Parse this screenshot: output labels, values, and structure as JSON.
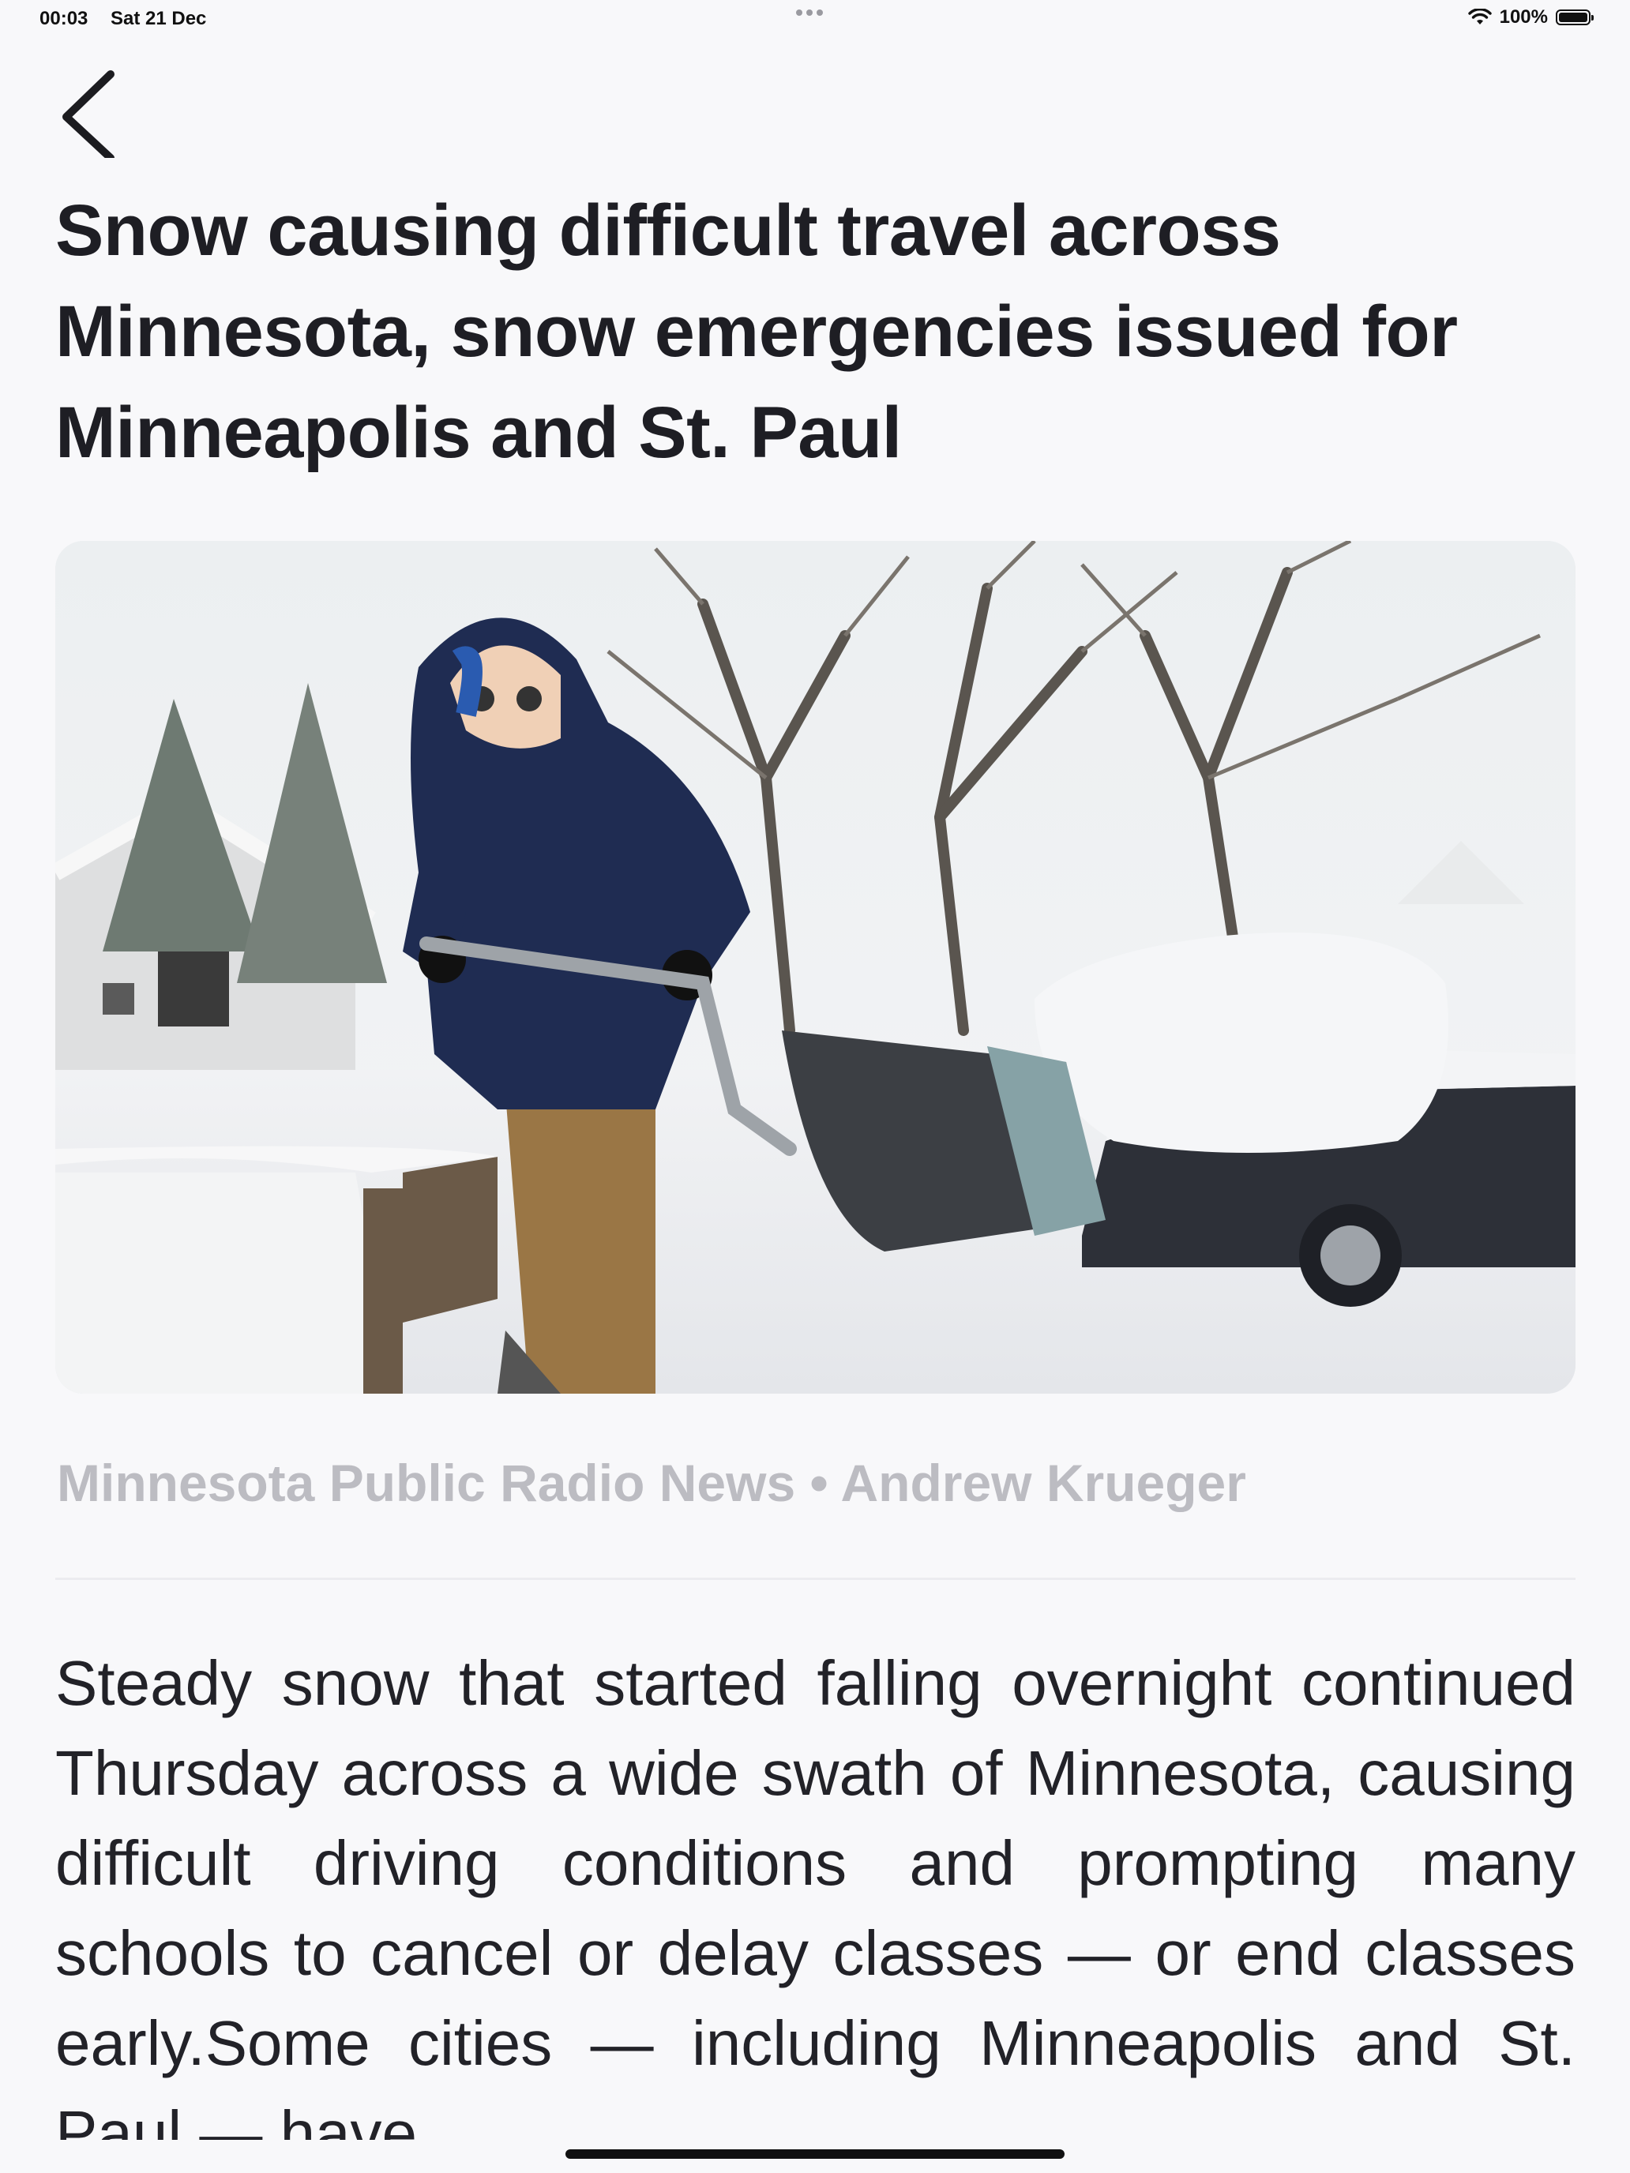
{
  "status_bar": {
    "time": "00:03",
    "date": "Sat 21 Dec",
    "battery": "100%"
  },
  "navigation": {
    "back_icon": "chevron-left-icon"
  },
  "article": {
    "title": "Snow causing difficult travel across Minnesota, snow emergencies issued for Minneapolis and St. Paul",
    "image_icon": "photo-snow-shoveling",
    "byline": "Minnesota Public Radio News • Andrew Krueger",
    "body": "Steady snow that started falling overnight continued Thursday across a wide swath of Minnesota, causing difficult driving conditions and prompting many schools to cancel or delay classes — or end classes early.Some cities — including Minneapolis and St. Paul — have"
  },
  "colors": {
    "background": "#f8f8fa",
    "title": "#1e1e24",
    "byline": "#bcbcc2",
    "body": "#222228"
  }
}
